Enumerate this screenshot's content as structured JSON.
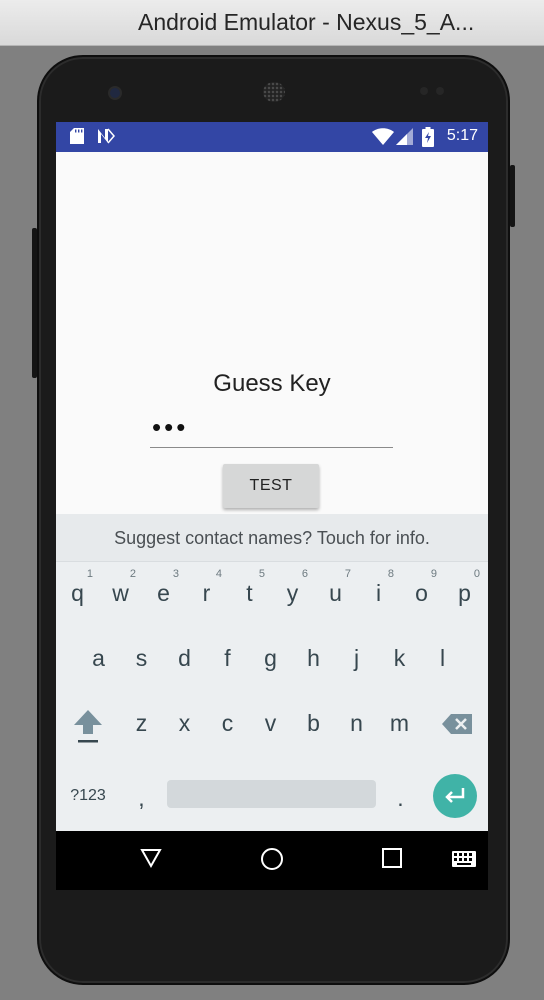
{
  "window": {
    "title": "Android Emulator - Nexus_5_A..."
  },
  "status_bar": {
    "time": "5:17",
    "left_icons": [
      "sd-card-icon",
      "n-logo-icon"
    ],
    "right_icons": [
      "wifi-icon",
      "signal-icon",
      "battery-charging-icon"
    ],
    "color": "#3346a5"
  },
  "app": {
    "label": "Guess Key",
    "key_field_value": "•••",
    "test_button_label": "TEST"
  },
  "keyboard": {
    "suggestion": "Suggest contact names? Touch for info.",
    "row1": [
      {
        "letter": "q",
        "hint": "1"
      },
      {
        "letter": "w",
        "hint": "2"
      },
      {
        "letter": "e",
        "hint": "3"
      },
      {
        "letter": "r",
        "hint": "4"
      },
      {
        "letter": "t",
        "hint": "5"
      },
      {
        "letter": "y",
        "hint": "6"
      },
      {
        "letter": "u",
        "hint": "7"
      },
      {
        "letter": "i",
        "hint": "8"
      },
      {
        "letter": "o",
        "hint": "9"
      },
      {
        "letter": "p",
        "hint": "0"
      }
    ],
    "row2": [
      "a",
      "s",
      "d",
      "f",
      "g",
      "h",
      "j",
      "k",
      "l"
    ],
    "row3": [
      "z",
      "x",
      "c",
      "v",
      "b",
      "n",
      "m"
    ],
    "symbols_label": "?123",
    "comma_label": ",",
    "period_label": ".",
    "enter_color": "#40b3a7"
  },
  "nav_bar": {
    "icons": [
      "back-icon",
      "home-icon",
      "recents-icon",
      "keyboard-switch-icon"
    ]
  }
}
